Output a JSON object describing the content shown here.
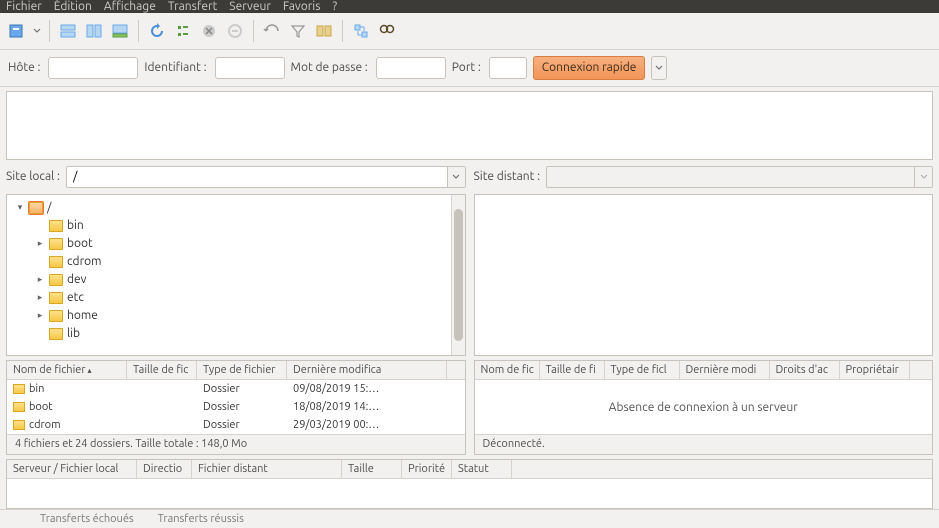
{
  "menu": [
    "Fichier",
    "Édition",
    "Affichage",
    "Transfert",
    "Serveur",
    "Favoris",
    "?"
  ],
  "quickconnect": {
    "host_label": "Hôte :",
    "user_label": "Identifiant :",
    "pass_label": "Mot de passe :",
    "port_label": "Port :",
    "button": "Connexion rapide"
  },
  "local": {
    "label": "Site local :",
    "path": "/",
    "tree": [
      {
        "name": "/",
        "depth": 0,
        "expander": "▾",
        "selected": true
      },
      {
        "name": "bin",
        "depth": 1,
        "expander": ""
      },
      {
        "name": "boot",
        "depth": 1,
        "expander": "▸"
      },
      {
        "name": "cdrom",
        "depth": 1,
        "expander": ""
      },
      {
        "name": "dev",
        "depth": 1,
        "expander": "▸"
      },
      {
        "name": "etc",
        "depth": 1,
        "expander": "▸"
      },
      {
        "name": "home",
        "depth": 1,
        "expander": "▸"
      },
      {
        "name": "lib",
        "depth": 1,
        "expander": ""
      }
    ],
    "columns": [
      "Nom de fichier",
      "Taille de fic",
      "Type de fichier",
      "Dernière modifica"
    ],
    "rows": [
      {
        "name": "bin",
        "size": "",
        "type": "Dossier",
        "date": "09/08/2019 15:…"
      },
      {
        "name": "boot",
        "size": "",
        "type": "Dossier",
        "date": "18/08/2019 14:…"
      },
      {
        "name": "cdrom",
        "size": "",
        "type": "Dossier",
        "date": "29/03/2019 00:…"
      }
    ],
    "status": "4 fichiers et 24 dossiers. Taille totale : 148,0 Mo"
  },
  "remote": {
    "label": "Site distant :",
    "path": "",
    "columns": [
      "Nom de fic",
      "Taille de fi",
      "Type de ficl",
      "Dernière modi",
      "Droits d'ac",
      "Propriétair"
    ],
    "empty": "Absence de connexion à un serveur",
    "status": "Déconnecté."
  },
  "queue": {
    "columns": [
      "Serveur / Fichier local",
      "Directio",
      "Fichier distant",
      "Taille",
      "Priorité",
      "Statut"
    ]
  },
  "footer_tabs": [
    "",
    "Transferts échoués",
    "Transferts réussis"
  ]
}
